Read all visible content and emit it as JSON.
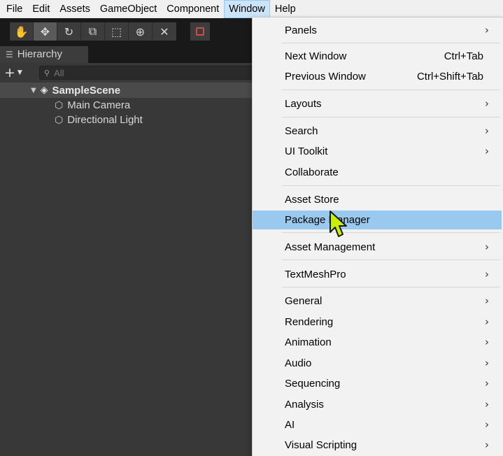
{
  "menubar": {
    "items": [
      "File",
      "Edit",
      "Assets",
      "GameObject",
      "Component",
      "Window",
      "Help"
    ],
    "active": "Window"
  },
  "toolbar": {
    "tools": [
      "hand-tool-icon",
      "move-tool-icon",
      "rotate-tool-icon",
      "scale-tool-icon",
      "rect-tool-icon",
      "transform-tool-icon",
      "custom-tool-icon"
    ],
    "selected": "move-tool-icon"
  },
  "hierarchy": {
    "tab_label": "Hierarchy",
    "search_placeholder": "All",
    "scene_name": "SampleScene",
    "objects": [
      "Main Camera",
      "Directional Light"
    ]
  },
  "window_menu": {
    "items": [
      {
        "label": "Panels",
        "submenu": true
      },
      {
        "label": "Next Window",
        "shortcut": "Ctrl+Tab"
      },
      {
        "label": "Previous Window",
        "shortcut": "Ctrl+Shift+Tab"
      },
      {
        "label": "Layouts",
        "submenu": true
      },
      {
        "label": "Search",
        "submenu": true
      },
      {
        "label": "UI Toolkit",
        "submenu": true
      },
      {
        "label": "Collaborate"
      },
      {
        "label": "Asset Store"
      },
      {
        "label": "Package Manager",
        "highlighted": true
      },
      {
        "label": "Asset Management",
        "submenu": true
      },
      {
        "label": "TextMeshPro",
        "submenu": true
      },
      {
        "label": "General",
        "submenu": true
      },
      {
        "label": "Rendering",
        "submenu": true
      },
      {
        "label": "Animation",
        "submenu": true
      },
      {
        "label": "Audio",
        "submenu": true
      },
      {
        "label": "Sequencing",
        "submenu": true
      },
      {
        "label": "Analysis",
        "submenu": true
      },
      {
        "label": "AI",
        "submenu": true
      },
      {
        "label": "Visual Scripting",
        "submenu": true
      }
    ]
  },
  "colors": {
    "menu_highlight": "#99c9ef",
    "menubar_active": "#cce4f7",
    "panel_bg": "#383838",
    "cursor_fill": "#c8f000"
  }
}
